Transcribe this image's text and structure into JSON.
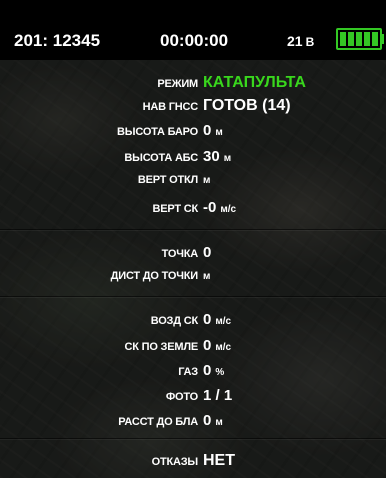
{
  "header": {
    "vehicle_id": "201: 12345",
    "timer": "00:00:00",
    "voltage": "21",
    "voltage_unit": "В",
    "battery_level": 1.0,
    "battery_color": "#34c924"
  },
  "colors": {
    "accent_green": "#39d71d"
  },
  "telemetry": {
    "mode": {
      "label": "РЕЖИМ",
      "value": "КАТАПУЛЬТА"
    },
    "gnss": {
      "label": "НАВ ГНСС",
      "value": "ГОТОВ (14)"
    },
    "baro_alt": {
      "label": "ВЫСОТА БАРО",
      "value": "0",
      "unit": "м"
    },
    "abs_alt": {
      "label": "ВЫСОТА АБС",
      "value": "30",
      "unit": "м"
    },
    "vert_dev": {
      "label": "ВЕРТ ОТКЛ",
      "value": "",
      "unit": "м"
    },
    "vert_speed": {
      "label": "ВЕРТ СК",
      "value": "-0",
      "unit": "м/с"
    },
    "point": {
      "label": "ТОЧКА",
      "value": "0"
    },
    "dist_to_point": {
      "label": "ДИСТ ДО ТОЧКИ",
      "value": "",
      "unit": "м"
    },
    "air_speed": {
      "label": "ВОЗД СК",
      "value": "0",
      "unit": "м/с"
    },
    "ground_speed": {
      "label": "СК ПО ЗЕМЛЕ",
      "value": "0",
      "unit": "м/с"
    },
    "throttle": {
      "label": "ГАЗ",
      "value": "0",
      "unit": "%"
    },
    "photo": {
      "label": "ФОТО",
      "value": "1 / 1"
    },
    "dist_to_uav": {
      "label": "РАССТ ДО БЛА",
      "value": "0",
      "unit": "м"
    },
    "failures": {
      "label": "ОТКАЗЫ",
      "value": "НЕТ"
    }
  }
}
